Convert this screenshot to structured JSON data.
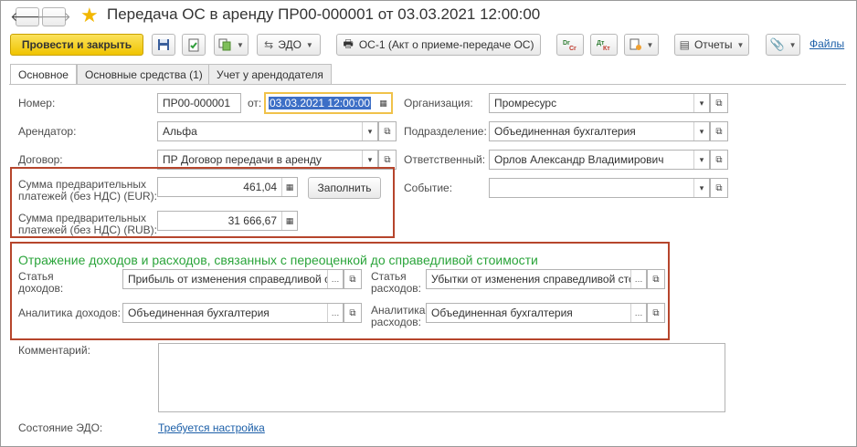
{
  "window": {
    "title": "Передача ОС в аренду ПР00-000001 от 03.03.2021 12:00:00",
    "back_glyph": "🡐",
    "forward_glyph": "🡒",
    "favorite_glyph": "★"
  },
  "toolbar": {
    "post_close": "Провести и закрыть",
    "edo": "ЭДО",
    "os1": "ОС-1 (Акт о приеме-передаче ОС)",
    "dt_cr_label": "Dr Cr",
    "dt_kt_label": "Дт Кт",
    "reports": "Отчеты",
    "files": "Файлы"
  },
  "tabs": [
    {
      "label": "Основное",
      "active": true
    },
    {
      "label": "Основные средства (1)",
      "active": false
    },
    {
      "label": "Учет у арендодателя",
      "active": false
    }
  ],
  "form": {
    "number_label": "Номер:",
    "number_value": "ПР00-000001",
    "date_label": "от:",
    "date_value": "03.03.2021 12:00:00",
    "lessee_label": "Арендатор:",
    "lessee_value": "Альфа",
    "contract_label": "Договор:",
    "contract_value": "ПР Договор передачи в аренду",
    "org_label": "Организация:",
    "org_value": "Промресурс",
    "dept_label": "Подразделение:",
    "dept_value": "Объединенная бухгалтерия",
    "resp_label": "Ответственный:",
    "resp_value": "Орлов Александр Владимирович",
    "event_label": "Событие:",
    "event_value": "",
    "prepay_eur_label_1": "Сумма предварительных",
    "prepay_eur_label_2": "платежей (без НДС) (EUR):",
    "prepay_eur_value": "461,04",
    "fill_button": "Заполнить",
    "prepay_rub_label_1": "Сумма предварительных",
    "prepay_rub_label_2": "платежей (без НДС) (RUB):",
    "prepay_rub_value": "31 666,67",
    "section_title": "Отражение доходов и расходов, связанных с переоценкой до справедливой стоимости",
    "income_item_label_1": "Статья",
    "income_item_label_2": "доходов:",
    "income_item_value": "Прибыль от изменения справедливой стоимости",
    "expense_item_label_1": "Статья",
    "expense_item_label_2": "расходов:",
    "expense_item_value": "Убытки от изменения справедливой стоимости",
    "income_analytics_label": "Аналитика доходов:",
    "income_analytics_value": "Объединенная бухгалтерия",
    "expense_analytics_label_1": "Аналитика",
    "expense_analytics_label_2": "расходов:",
    "expense_analytics_value": "Объединенная бухгалтерия",
    "comment_label": "Комментарий:",
    "comment_value": "",
    "edo_state_label": "Состояние ЭДО:",
    "edo_state_link": "Требуется настройка"
  },
  "colors": {
    "accent_yellow": "#f0c400",
    "highlight_box": "#b6452c",
    "section_green": "#2aa43a",
    "link_blue": "#1c5fa8"
  }
}
